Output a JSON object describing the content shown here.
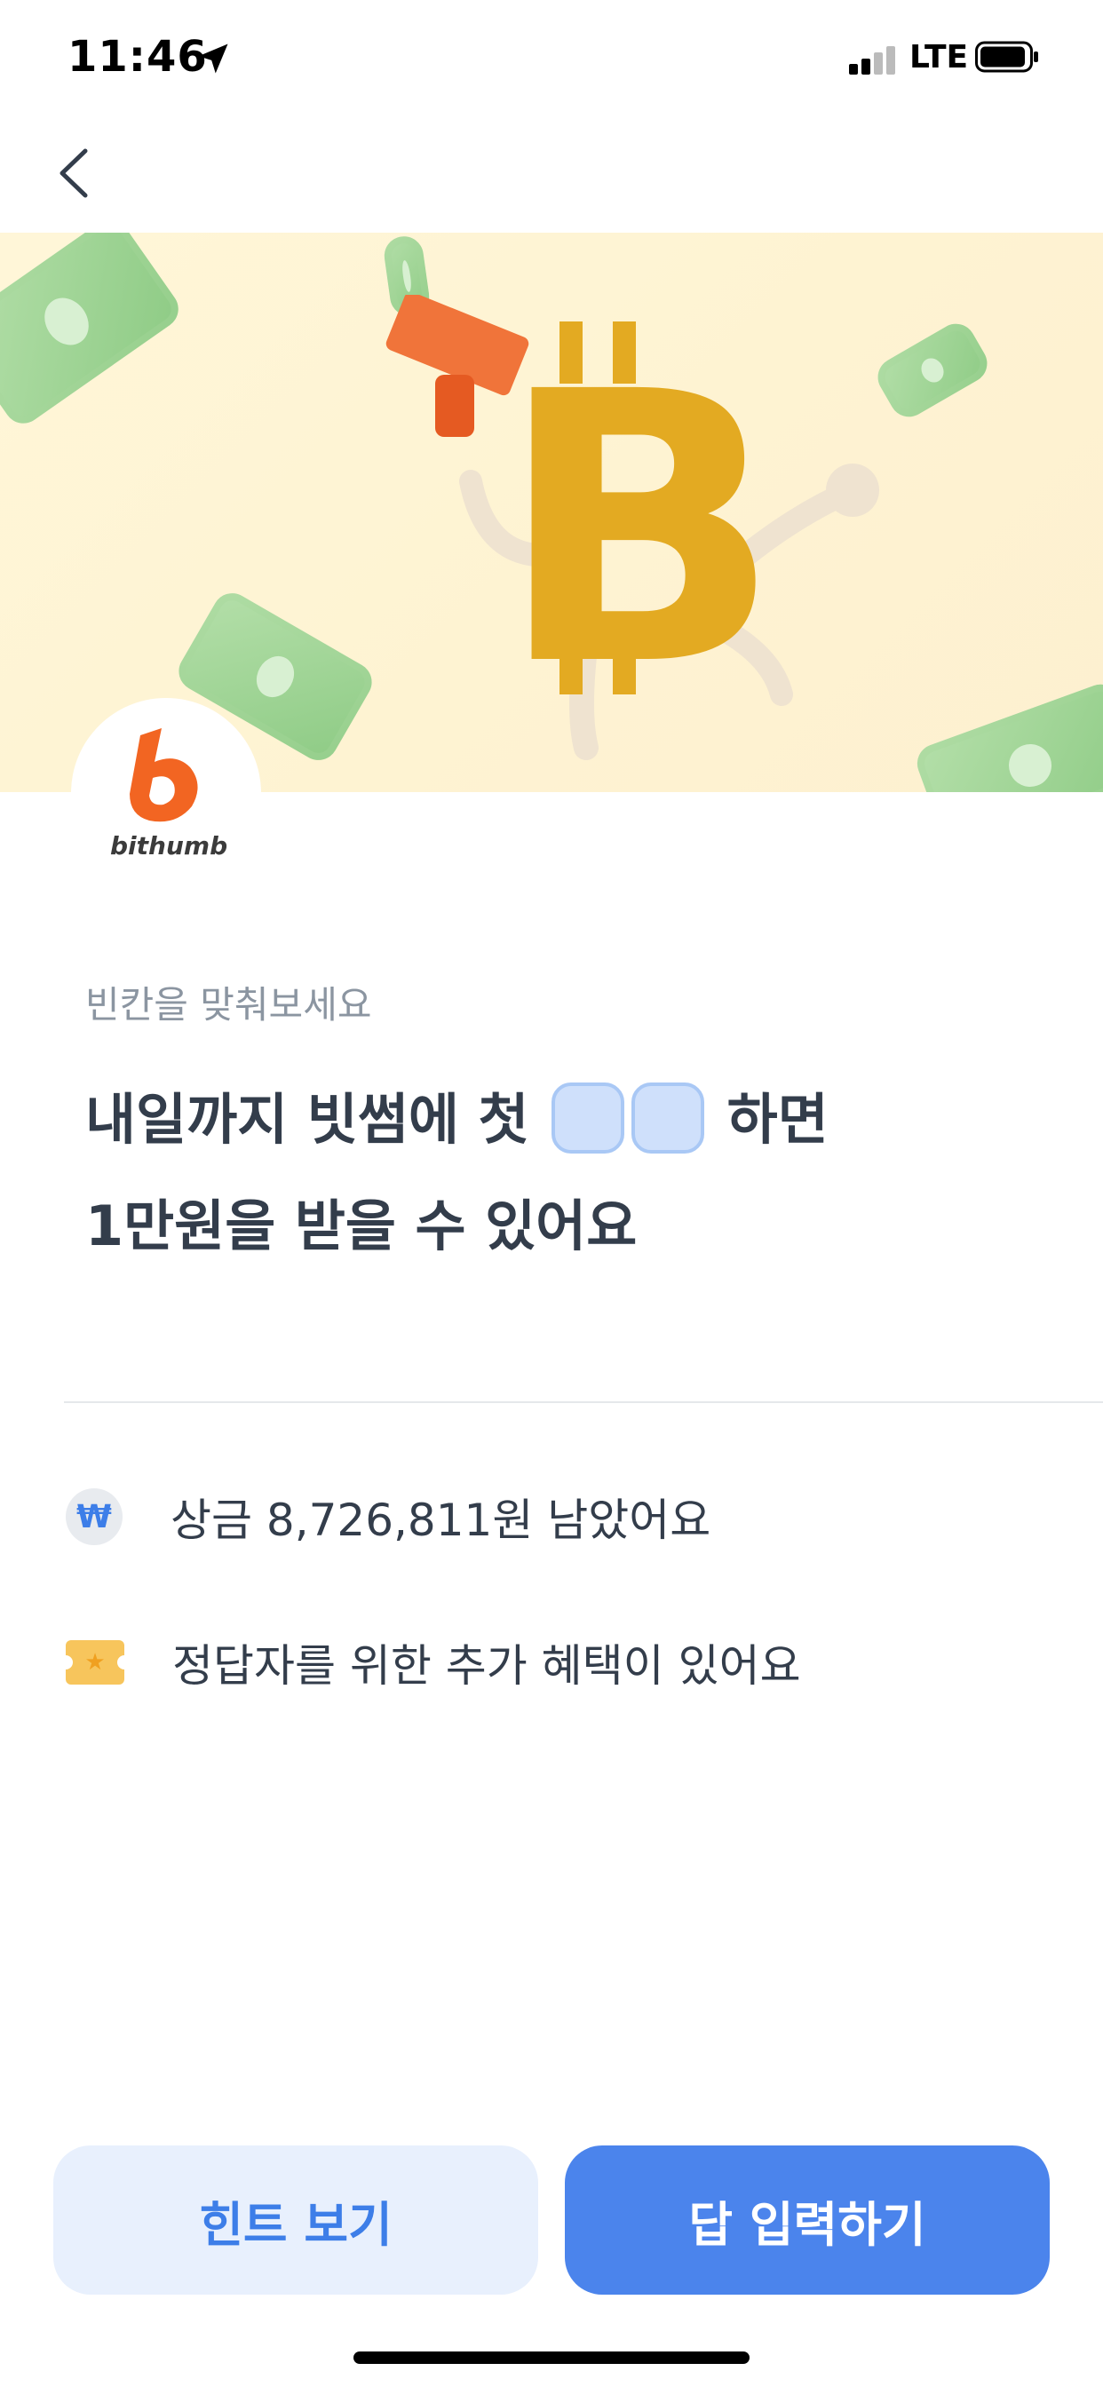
{
  "status_bar": {
    "time": "11:46",
    "network": "LTE"
  },
  "nav": {
    "back_icon": "chevron-left-icon"
  },
  "banner": {
    "logo_text": "bithumb",
    "accent_color": "#f26522",
    "coin_color": "#e8b22a"
  },
  "quiz": {
    "prompt": "빈칸을 맞춰보세요",
    "line1_before": "내일까지 빗썸에 첫 ",
    "line1_after": " 하면",
    "line2": "1만원을 받을 수 있어요",
    "blank_count": 2
  },
  "info": {
    "prize_icon": "won-icon",
    "prize_text": "상금 8,726,811원 남았어요",
    "benefit_icon": "ticket-icon",
    "benefit_text": "정답자를 위한 추가 혜택이 있어요"
  },
  "buttons": {
    "hint_label": "힌트 보기",
    "answer_label": "답 입력하기"
  },
  "colors": {
    "primary": "#4b84ec",
    "primary_light": "#e8f0fd",
    "text_main": "#333d4b",
    "text_sub": "#8b95a1"
  }
}
